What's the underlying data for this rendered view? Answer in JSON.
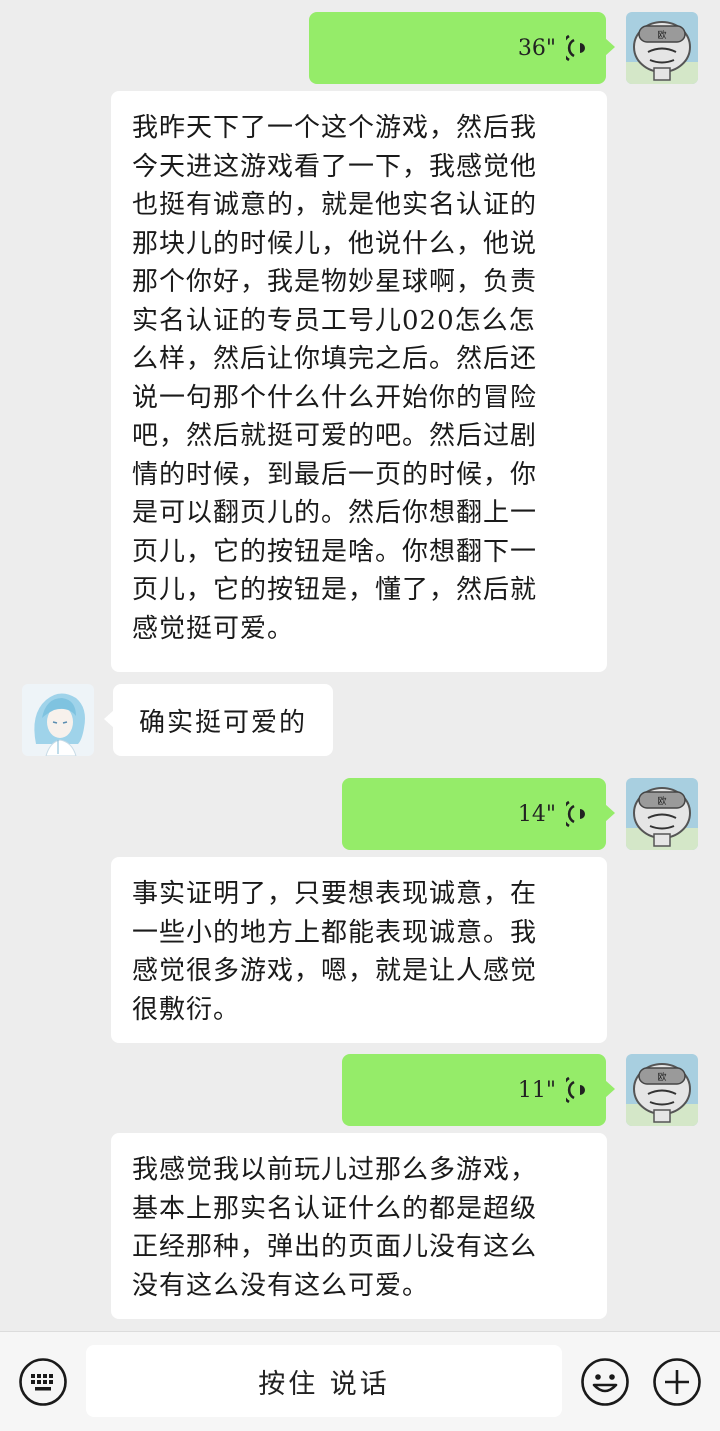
{
  "messages": {
    "voice1": {
      "duration": "36\""
    },
    "transcript1": {
      "text": "我昨天下了一个这个游戏，然后我\n今天进这游戏看了一下，我感觉他\n也挺有诚意的，就是他实名认证的\n那块儿的时候儿，他说什么，他说\n那个你好，我是物妙星球啊，负责\n实名认证的专员工号儿020怎么怎\n么样，然后让你填完之后。然后还\n说一句那个什么什么开始你的冒险\n吧，然后就挺可爱的吧。然后过剧\n情的时候，到最后一页的时候，你\n是可以翻页儿的。然后你想翻上一\n页儿，它的按钮是啥。你想翻下一\n页儿，它的按钮是，懂了，然后就\n感觉挺可爱。"
    },
    "incoming1": {
      "text": "确实挺可爱的"
    },
    "voice2": {
      "duration": "14\""
    },
    "transcript2": {
      "text": "事实证明了，只要想表现诚意，在\n一些小的地方上都能表现诚意。我\n感觉很多游戏，嗯，就是让人感觉\n很敷衍。"
    },
    "voice3": {
      "duration": "11\""
    },
    "transcript3": {
      "text": "我感觉我以前玩儿过那么多游戏，\n基本上那实名认证什么的都是超级\n正经那种，弹出的页面儿没有这么\n没有这么没有这么可爱。"
    }
  },
  "avatar_badge": "欧",
  "bottombar": {
    "keyboard_icon": "keyboard-icon",
    "hold_to_talk_label": "按住 说话",
    "emoji_icon": "emoji-icon",
    "plus_icon": "plus-icon"
  },
  "colors": {
    "background": "#ededed",
    "outgoing_bubble": "#95ec69",
    "incoming_bubble": "#ffffff",
    "bottombar": "#f6f6f6"
  }
}
